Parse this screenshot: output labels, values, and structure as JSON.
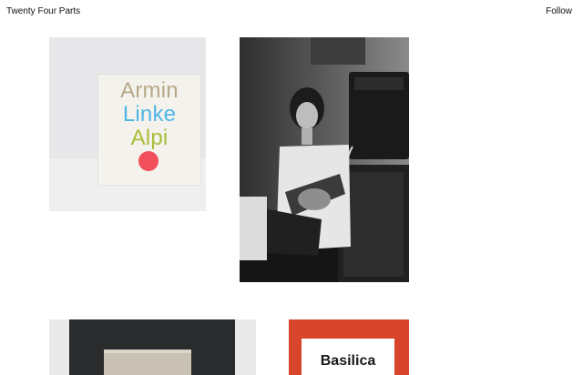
{
  "header": {
    "site_title": "Twenty Four Parts",
    "follow_label": "Follow"
  },
  "gallery": {
    "items": [
      {
        "name": "armin-linke-alpi",
        "cover_words": [
          "Armin",
          "Linke",
          "Alpi"
        ]
      },
      {
        "name": "guitarist-photo"
      },
      {
        "name": "book-photo"
      },
      {
        "name": "basilica",
        "cover_title": "Basilica"
      }
    ]
  },
  "colors": {
    "armin": "#b8a888",
    "linke": "#4fb6e6",
    "alpi": "#a9bd3b",
    "dot": "#f24f5c",
    "basilica_red": "#d9452a"
  }
}
